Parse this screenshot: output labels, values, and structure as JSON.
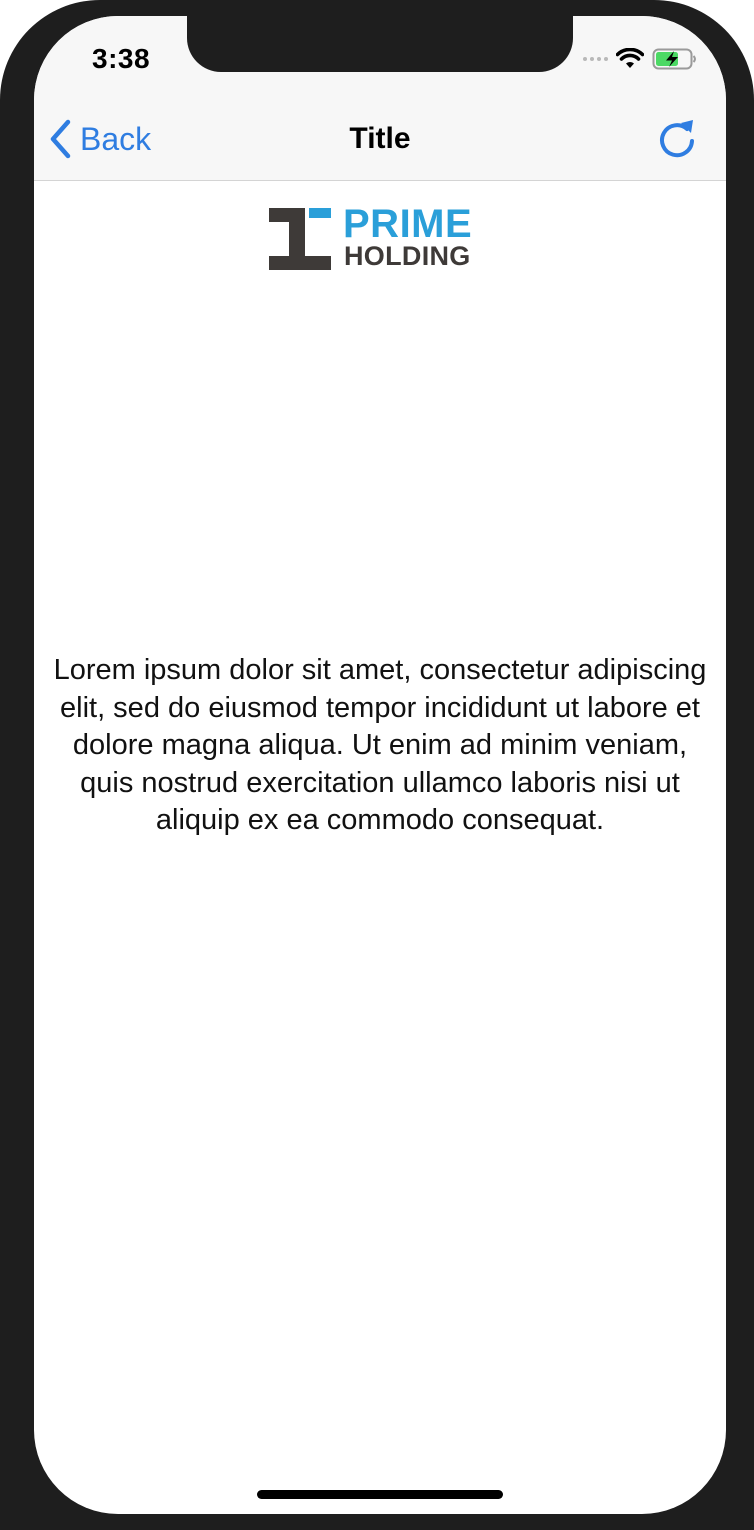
{
  "status_bar": {
    "time": "3:38",
    "icons": [
      "signal-dots-icon",
      "wifi-icon",
      "battery-charging-icon"
    ]
  },
  "nav_bar": {
    "back_label": "Back",
    "title": "Title",
    "back_icon": "chevron-left-icon",
    "reload_icon": "reload-icon"
  },
  "logo": {
    "line1": "PRIME",
    "line2": "HOLDING"
  },
  "content": {
    "paragraph": "Lorem ipsum dolor sit amet, consectetur adipiscing elit, sed do eiusmod tempor incididunt ut labore et dolore magna aliqua. Ut enim ad minim veniam, quis nostrud exercitation ullamco laboris nisi ut aliquip ex ea commodo consequat."
  },
  "colors": {
    "accent": "#2f7de1",
    "logo_blue": "#2a9fd9",
    "logo_dark": "#3e3a38",
    "bar_background": "#f7f7f7",
    "device_frame": "#1e1e1e"
  }
}
